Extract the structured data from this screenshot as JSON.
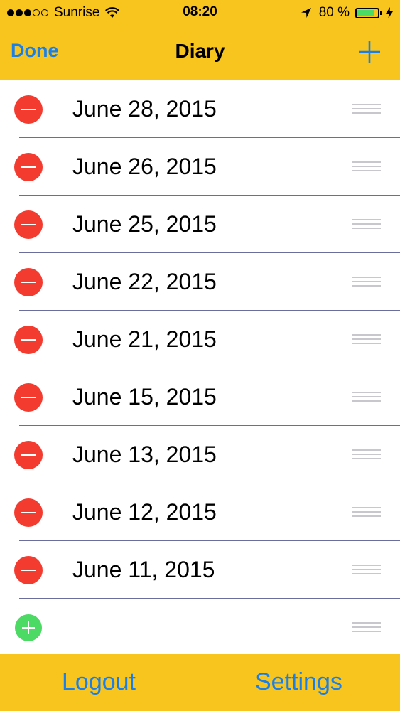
{
  "status_bar": {
    "carrier": "Sunrise",
    "time": "08:20",
    "battery_percent": "80 %",
    "battery_level": 0.8,
    "signal_bars_filled": 3,
    "signal_bars_total": 5
  },
  "nav": {
    "done_label": "Done",
    "title": "Diary"
  },
  "entries": [
    {
      "date": "June 28, 2015"
    },
    {
      "date": "June 26, 2015"
    },
    {
      "date": "June 25, 2015"
    },
    {
      "date": "June 22, 2015"
    },
    {
      "date": "June 21, 2015"
    },
    {
      "date": "June 15, 2015"
    },
    {
      "date": "June 13, 2015"
    },
    {
      "date": "June 12, 2015"
    },
    {
      "date": "June 11, 2015"
    }
  ],
  "toolbar": {
    "logout_label": "Logout",
    "settings_label": "Settings"
  },
  "colors": {
    "bar_background": "#f7c51e",
    "accent": "#1a7fe8",
    "delete": "#f33b30",
    "insert": "#4cd964",
    "separator": "#6b6d9c"
  }
}
